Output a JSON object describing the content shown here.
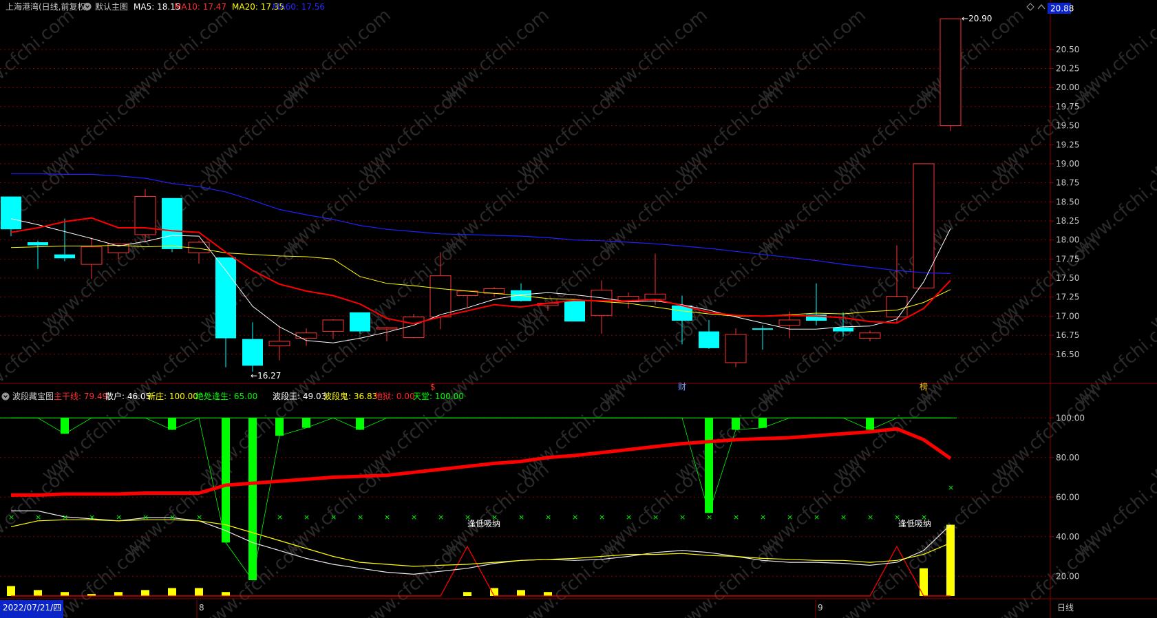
{
  "header_main": {
    "title": "上海港湾(日线,前复权)",
    "indicator_name": "默认主图",
    "ma5_label": "MA5:",
    "ma5_value": "18.15",
    "ma10_label": "MA10:",
    "ma10_value": "17.47",
    "ma20_label": "MA20:",
    "ma20_value": "17.35",
    "ma60_label": "MA60:",
    "ma60_value": "17.56",
    "current_price": "20.88"
  },
  "header_sub": {
    "indicator_name": "波段藏宝图",
    "v1_label": "主干线:",
    "v1_value": "79.49",
    "v2_label": "散户:",
    "v2_value": "46.05",
    "v3_label": "新庄:",
    "v3_value": "100.00",
    "v4_label": "绝处逢生:",
    "v4_value": "65.00",
    "v5_label": "波段王:",
    "v5_value": "49.03",
    "v6_label": "波段鬼:",
    "v6_value": "36.83",
    "v7_label": "地狱:",
    "v7_value": "0.00",
    "v8_label": "天堂:",
    "v8_value": "100.00"
  },
  "colors": {
    "up": "#ff3232",
    "down": "#00ffff",
    "ma5": "#ffffff",
    "ma10": "#ff0000",
    "ma20": "#ffff00",
    "ma60": "#2020ff",
    "grid": "#8b0000",
    "axis_text": "#c8c8c8",
    "green": "#00ff00",
    "yellow": "#ffff00",
    "red": "#ff0000"
  },
  "annotations": {
    "high_marker": "20.90",
    "low_marker": "16.27",
    "event1": "$",
    "event2": "财",
    "event3": "榜",
    "signal_text": "逢低吸纳",
    "watermark": "www.cfchi.com"
  },
  "footer": {
    "date": "2022/07/21/四",
    "month1": "8",
    "month2": "9",
    "period": "日线"
  },
  "chart_data": [
    {
      "type": "candlestick",
      "ylim": [
        16.2,
        20.95
      ],
      "y_ticks": [
        "20.50",
        "20.25",
        "20.00",
        "19.75",
        "19.50",
        "19.25",
        "19.00",
        "18.75",
        "18.50",
        "18.25",
        "18.00",
        "17.75",
        "17.50",
        "17.25",
        "17.00",
        "16.75",
        "16.50"
      ],
      "candles": [
        {
          "o": 18.57,
          "h": 18.57,
          "l": 18.05,
          "c": 18.14
        },
        {
          "o": 17.97,
          "h": 17.99,
          "l": 17.62,
          "c": 17.93
        },
        {
          "o": 17.81,
          "h": 18.28,
          "l": 17.72,
          "c": 17.76
        },
        {
          "o": 17.68,
          "h": 18.03,
          "l": 17.49,
          "c": 17.91
        },
        {
          "o": 17.83,
          "h": 17.93,
          "l": 17.75,
          "c": 17.95
        },
        {
          "o": 18.07,
          "h": 18.67,
          "l": 17.99,
          "c": 18.57
        },
        {
          "o": 18.55,
          "h": 18.55,
          "l": 17.84,
          "c": 17.88
        },
        {
          "o": 17.83,
          "h": 17.99,
          "l": 17.69,
          "c": 17.97
        },
        {
          "o": 17.77,
          "h": 17.77,
          "l": 16.33,
          "c": 16.71
        },
        {
          "o": 16.7,
          "h": 16.92,
          "l": 16.27,
          "c": 16.35
        },
        {
          "o": 16.61,
          "h": 16.87,
          "l": 16.42,
          "c": 16.67
        },
        {
          "o": 16.71,
          "h": 16.84,
          "l": 16.61,
          "c": 16.78
        },
        {
          "o": 16.8,
          "h": 16.96,
          "l": 16.7,
          "c": 16.95
        },
        {
          "o": 17.05,
          "h": 17.05,
          "l": 16.77,
          "c": 16.8
        },
        {
          "o": 16.85,
          "h": 16.86,
          "l": 16.67,
          "c": 16.85
        },
        {
          "o": 16.72,
          "h": 17.03,
          "l": 16.71,
          "c": 16.99
        },
        {
          "o": 16.99,
          "h": 17.84,
          "l": 16.83,
          "c": 17.53
        },
        {
          "o": 17.27,
          "h": 17.3,
          "l": 17.12,
          "c": 17.33
        },
        {
          "o": 17.3,
          "h": 17.38,
          "l": 17.25,
          "c": 17.36
        },
        {
          "o": 17.34,
          "h": 17.43,
          "l": 17.19,
          "c": 17.2
        },
        {
          "o": 17.14,
          "h": 17.18,
          "l": 17.07,
          "c": 17.17
        },
        {
          "o": 17.2,
          "h": 17.22,
          "l": 16.93,
          "c": 16.93
        },
        {
          "o": 17.01,
          "h": 17.47,
          "l": 16.77,
          "c": 17.34
        },
        {
          "o": 17.19,
          "h": 17.31,
          "l": 17.1,
          "c": 17.26
        },
        {
          "o": 17.22,
          "h": 17.82,
          "l": 17.15,
          "c": 17.29
        },
        {
          "o": 17.14,
          "h": 17.27,
          "l": 16.63,
          "c": 16.94
        },
        {
          "o": 16.8,
          "h": 16.95,
          "l": 16.57,
          "c": 16.58
        },
        {
          "o": 16.39,
          "h": 16.84,
          "l": 16.33,
          "c": 16.76
        },
        {
          "o": 16.84,
          "h": 16.88,
          "l": 16.56,
          "c": 16.83
        },
        {
          "o": 16.88,
          "h": 17.06,
          "l": 16.71,
          "c": 16.95
        },
        {
          "o": 17.02,
          "h": 17.43,
          "l": 16.88,
          "c": 16.94
        },
        {
          "o": 16.85,
          "h": 17.05,
          "l": 16.73,
          "c": 16.8
        },
        {
          "o": 16.71,
          "h": 16.81,
          "l": 16.67,
          "c": 16.78
        },
        {
          "o": 16.99,
          "h": 17.93,
          "l": 16.9,
          "c": 17.26
        },
        {
          "o": 17.37,
          "h": 19.0,
          "l": 17.37,
          "c": 19.0
        },
        {
          "o": 19.5,
          "h": 20.9,
          "l": 19.43,
          "c": 20.9
        }
      ],
      "ma5": [
        18.28,
        18.2,
        18.11,
        18.02,
        17.92,
        17.98,
        18.06,
        18.05,
        17.6,
        17.13,
        16.86,
        16.68,
        16.65,
        16.71,
        16.79,
        16.88,
        17.02,
        17.11,
        17.22,
        17.28,
        17.31,
        17.28,
        17.24,
        17.19,
        17.2,
        17.15,
        17.08,
        16.99,
        16.91,
        16.83,
        16.83,
        16.86,
        16.87,
        16.96,
        17.45,
        18.15
      ],
      "ma10": [
        18.1,
        18.16,
        18.24,
        18.29,
        18.16,
        18.16,
        18.12,
        18.1,
        17.84,
        17.6,
        17.42,
        17.33,
        17.27,
        17.16,
        16.97,
        16.9,
        16.99,
        17.07,
        17.15,
        17.12,
        17.17,
        17.21,
        17.2,
        17.2,
        17.22,
        17.14,
        17.05,
        17.01,
        17.0,
        17.01,
        17.0,
        16.98,
        16.93,
        16.91,
        17.1,
        17.47
      ],
      "ma20": [
        17.9,
        17.91,
        17.92,
        17.92,
        17.93,
        17.91,
        17.92,
        17.89,
        17.83,
        17.81,
        17.79,
        17.78,
        17.75,
        17.52,
        17.43,
        17.4,
        17.36,
        17.33,
        17.3,
        17.27,
        17.23,
        17.22,
        17.19,
        17.17,
        17.12,
        17.07,
        17.03,
        17.0,
        17.0,
        17.02,
        17.04,
        17.03,
        17.06,
        17.08,
        17.18,
        17.35
      ],
      "ma60": [
        18.87,
        18.87,
        18.86,
        18.86,
        18.84,
        18.81,
        18.74,
        18.7,
        18.63,
        18.52,
        18.4,
        18.33,
        18.27,
        18.19,
        18.14,
        18.11,
        18.08,
        18.07,
        18.06,
        18.05,
        18.03,
        18.0,
        17.99,
        17.97,
        17.95,
        17.92,
        17.89,
        17.85,
        17.81,
        17.77,
        17.73,
        17.68,
        17.64,
        17.6,
        17.57,
        17.56
      ]
    },
    {
      "type": "line",
      "ylim": [
        10,
        106
      ],
      "y_ticks": [
        "100.00",
        "80.00",
        "60.00",
        "40.00",
        "20.00"
      ],
      "main_line": [
        61,
        61,
        61.5,
        61.5,
        61.5,
        62,
        62,
        62,
        66,
        67,
        68,
        69,
        70,
        70.5,
        71,
        72.5,
        74,
        75.5,
        77,
        78,
        80,
        81,
        82.5,
        84,
        85.5,
        87,
        88,
        89,
        89.5,
        90,
        91,
        92,
        93,
        94.5,
        89,
        79.49
      ],
      "white_line": [
        53,
        53,
        50,
        49,
        48,
        49.5,
        49.5,
        48,
        43,
        37,
        33,
        29,
        26,
        24,
        22,
        21,
        22.5,
        24,
        26.5,
        28,
        28.5,
        28,
        28.5,
        30,
        32,
        33,
        32,
        30,
        28,
        27,
        27,
        26.5,
        25.5,
        27,
        33,
        46.05
      ],
      "yellow_line": [
        45,
        48,
        48.5,
        48.5,
        48,
        48.5,
        48.5,
        48,
        46,
        42,
        38,
        34,
        30,
        27,
        26,
        25,
        25.5,
        26,
        27,
        28,
        28.5,
        29,
        30,
        31,
        31,
        31.5,
        30.5,
        30,
        29,
        28.5,
        28,
        28,
        27,
        28,
        31,
        36.83
      ],
      "green_bars_from_top": [
        100,
        100,
        92,
        100,
        100,
        100,
        94,
        100,
        37,
        18,
        91,
        95,
        100,
        94,
        100,
        100,
        100,
        100,
        100,
        100,
        100,
        100,
        100,
        100,
        100,
        100,
        52,
        94,
        95,
        100,
        100,
        100,
        94,
        100,
        100,
        100
      ],
      "green_cross": [
        50,
        50,
        50,
        50,
        50,
        50,
        50,
        50,
        50,
        50,
        50,
        50,
        50,
        50,
        50,
        50,
        50,
        50,
        50,
        50,
        50,
        50,
        50,
        50,
        50,
        50,
        50,
        50,
        50,
        50,
        50,
        50,
        50,
        50,
        50,
        65
      ],
      "yellow_bars": [
        15,
        13,
        12,
        11,
        12,
        13,
        14,
        14,
        12,
        10,
        10,
        10,
        10,
        10,
        10,
        10,
        10,
        12,
        14,
        13,
        12,
        10,
        10,
        10,
        10,
        10,
        10,
        10,
        10,
        10,
        10,
        10,
        10,
        10,
        24,
        46
      ],
      "red_signal": [
        10,
        10,
        10,
        10,
        10,
        10,
        10,
        10,
        10,
        10,
        10,
        10,
        10,
        10,
        10,
        10,
        10,
        35,
        10,
        10,
        10,
        10,
        10,
        10,
        10,
        10,
        10,
        10,
        10,
        10,
        10,
        10,
        10,
        35,
        10,
        10
      ]
    }
  ]
}
